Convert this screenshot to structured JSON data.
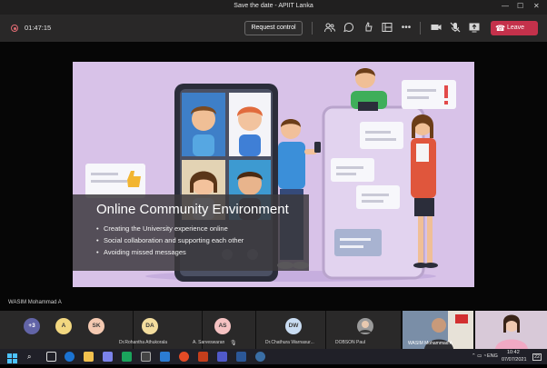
{
  "window": {
    "title": "Save the date - APIIT Lanka"
  },
  "toolbar": {
    "timer": "01:47:15",
    "request_control_label": "Request control",
    "leave_label": "Leave"
  },
  "slide": {
    "title": "Online Community Environment",
    "bullets": [
      "Creating the University experience online",
      "Social collaboration and supporting each other",
      "Avoiding missed messages"
    ]
  },
  "presenter": {
    "name": "WASIM Mohammad A"
  },
  "participants": [
    {
      "initials": "+3",
      "name": "",
      "color": "#6264a7"
    },
    {
      "initials": "A",
      "name": "",
      "color": "#f2d780"
    },
    {
      "initials": "SK",
      "name": "",
      "color": "#f4c9b1"
    },
    {
      "initials": "DA",
      "name": "Dr.Rohantha Athukorala",
      "color": "#f3dd9e"
    },
    {
      "initials": "AS",
      "name": "A. Sarveswaran",
      "color": "#f5c2c2"
    },
    {
      "initials": "DW",
      "name": "Dr.Chathura Warnasur...",
      "color": "#c9dcf2"
    },
    {
      "initials": "",
      "name": "DOBSON Paul",
      "color": "#9a9a9a"
    },
    {
      "initials": "",
      "name": "WASIM Mohammad A",
      "color": "#555"
    }
  ],
  "taskbar": {
    "time": "10:42",
    "date": "07/07/2021",
    "language": "ENG",
    "notification_count": "22"
  }
}
